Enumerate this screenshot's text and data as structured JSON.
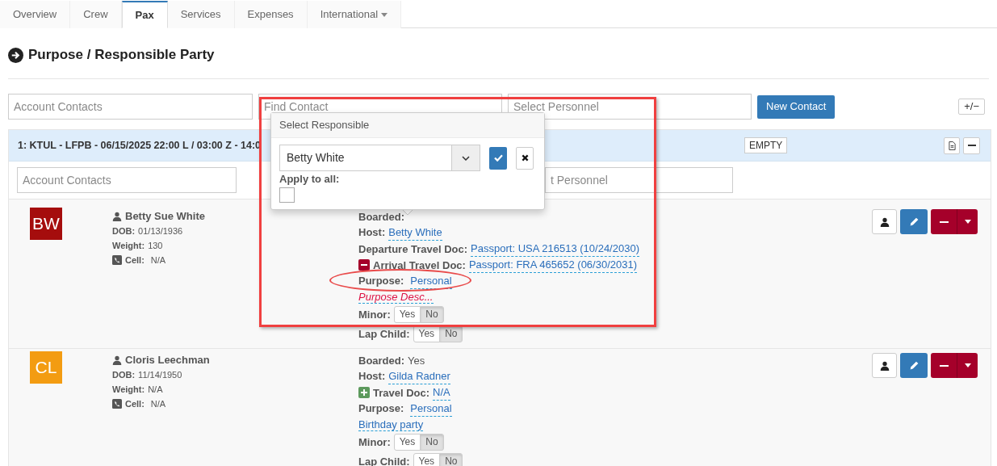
{
  "tabs": [
    {
      "label": "Overview",
      "selected": false,
      "dropdown": false
    },
    {
      "label": "Crew",
      "selected": false,
      "dropdown": false
    },
    {
      "label": "Pax",
      "selected": true,
      "dropdown": false
    },
    {
      "label": "Services",
      "selected": false,
      "dropdown": false
    },
    {
      "label": "Expenses",
      "selected": false,
      "dropdown": false
    },
    {
      "label": "International",
      "selected": false,
      "dropdown": true
    }
  ],
  "heading": "Purpose / Responsible Party",
  "top_fields": [
    {
      "placeholder": "Account Contacts"
    },
    {
      "placeholder": "Find Contact"
    },
    {
      "placeholder": "Select Personnel"
    }
  ],
  "new_contact_button": "New Contact",
  "expand_button": "+/−",
  "leg": {
    "title": "1: KTUL - LFPB - 06/15/2025 22:00 L / 03:00 Z - 14:0",
    "badge": "EMPTY",
    "fields": [
      {
        "placeholder": "Account Contacts"
      },
      {
        "placeholder": "t Personnel"
      }
    ]
  },
  "popover": {
    "title": "Select Responsible",
    "value": "Betty White",
    "apply_label": "Apply to all:",
    "apply_checked": false
  },
  "passengers": [
    {
      "initials": "BW",
      "color": "#a50d0d",
      "name": "Betty Sue White",
      "dob_label": "DOB:",
      "dob": "01/13/1936",
      "weight_label": "Weight:",
      "weight": "130",
      "cell_label": "Cell:",
      "cell": "N/A",
      "boarded_label": "Boarded:",
      "host_label": "Host:",
      "host": "Betty White",
      "docs": [
        {
          "kind": "none",
          "label": "Departure Travel Doc:",
          "value": "Passport: USA 216513 (10/24/2030)"
        },
        {
          "kind": "remove",
          "label": "Arrival Travel Doc:",
          "value": "Passport: FRA 465652 (06/30/2031)"
        }
      ],
      "purpose_label": "Purpose:",
      "purpose": "Personal",
      "description": "Purpose Desc...",
      "description_empty": true,
      "minor_label": "Minor:",
      "minor": [
        {
          "label": "Yes",
          "selected": false
        },
        {
          "label": "No",
          "selected": true
        }
      ],
      "lap_label": "Lap Child:",
      "lap_child": [
        {
          "label": "Yes",
          "selected": false
        },
        {
          "label": "No",
          "selected": true
        }
      ]
    },
    {
      "initials": "CL",
      "color": "#f39c12",
      "name": "Cloris Leechman",
      "dob_label": "DOB:",
      "dob": "11/14/1950",
      "weight_label": "Weight:",
      "weight": "N/A",
      "cell_label": "Cell:",
      "cell": "N/A",
      "boarded_label": "Boarded:",
      "boarded": "Yes",
      "host_label": "Host:",
      "host": "Gilda Radner",
      "docs": [
        {
          "kind": "add",
          "label": "Travel Doc:",
          "value": "N/A"
        }
      ],
      "purpose_label": "Purpose:",
      "purpose": "Personal",
      "description": "Birthday party",
      "description_empty": false,
      "minor_label": "Minor:",
      "minor": [
        {
          "label": "Yes",
          "selected": false
        },
        {
          "label": "No",
          "selected": true
        }
      ],
      "lap_label": "Lap Child:",
      "lap_child": [
        {
          "label": "Yes",
          "selected": false
        },
        {
          "label": "No",
          "selected": true
        }
      ]
    }
  ]
}
